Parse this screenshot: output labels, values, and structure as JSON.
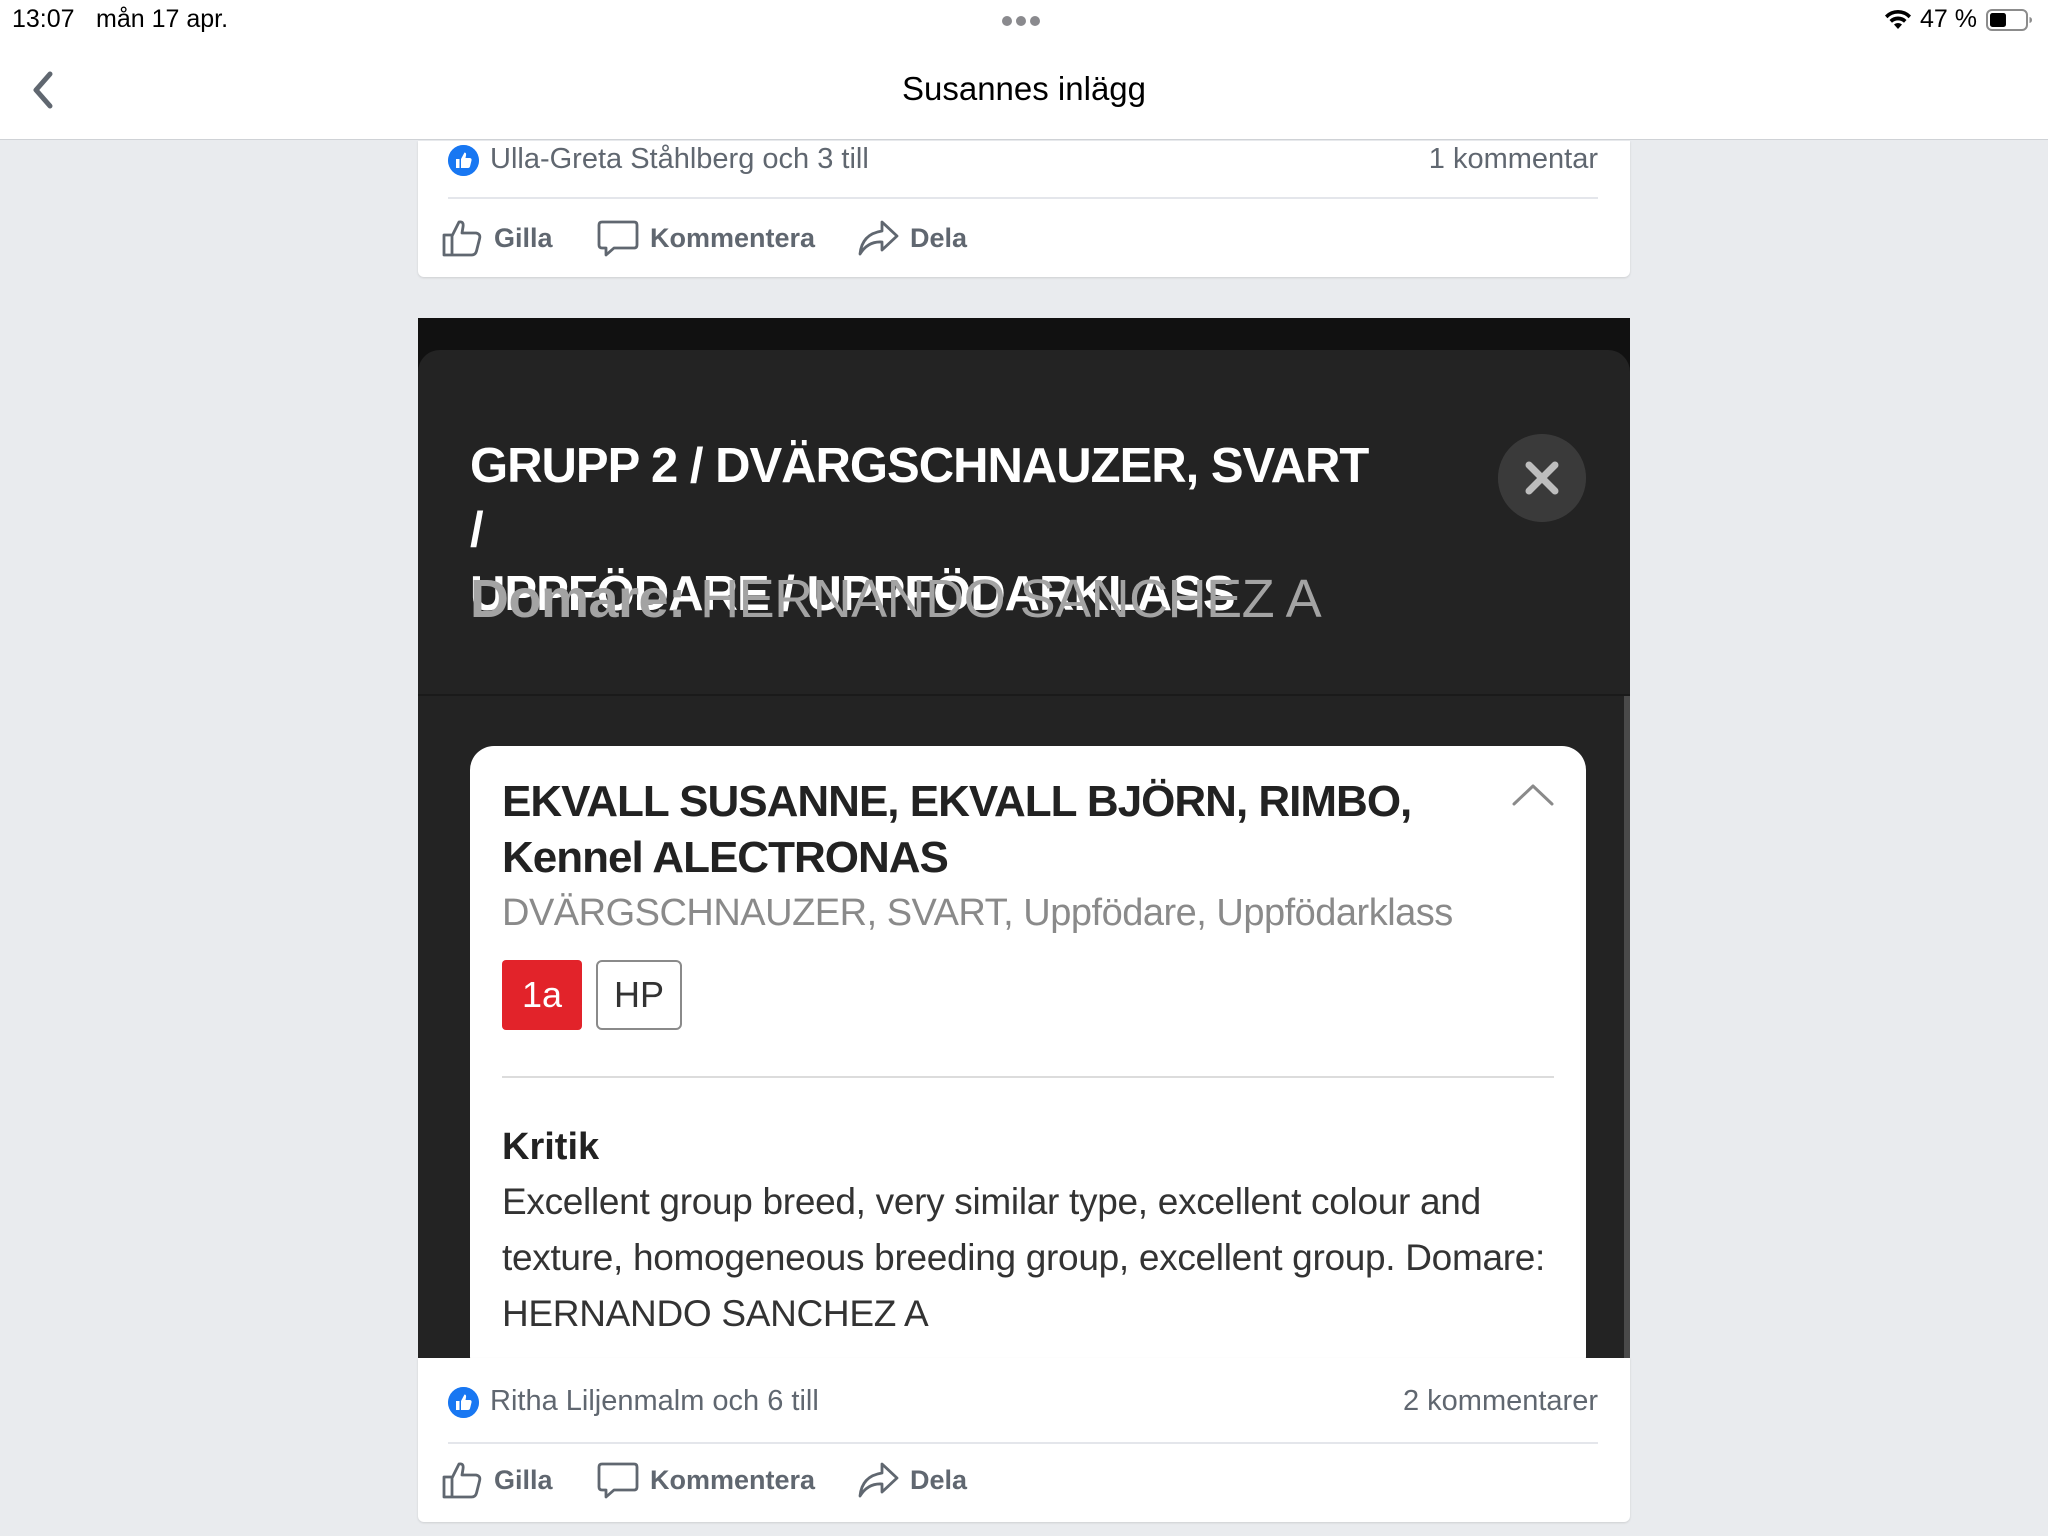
{
  "status_bar": {
    "time": "13:07",
    "date": "mån 17 apr.",
    "battery_percent": "47 %",
    "battery_level": 0.47,
    "icons": [
      "more-dots-icon",
      "wifi-icon",
      "battery-icon"
    ]
  },
  "nav": {
    "title": "Susannes inlägg",
    "back_icon": "chevron-left-icon"
  },
  "colors": {
    "facebook_blue": "#1877f2",
    "action_grey": "#606770",
    "placement_red": "#e2232a",
    "sheet_dark": "#232323"
  },
  "post_top": {
    "reactions_text": "Ulla-Greta Ståhlberg och 3 till",
    "comments_text": "1 kommentar",
    "actions": [
      {
        "label": "Gilla",
        "icon": "thumbs-up-icon"
      },
      {
        "label": "Kommentera",
        "icon": "comment-bubble-icon"
      },
      {
        "label": "Dela",
        "icon": "share-arrow-icon"
      }
    ]
  },
  "post_image": {
    "title_line1": "GRUPP 2 / DVÄRGSCHNAUZER, SVART /",
    "title_line2": "UPPFÖDARE / UPPFÖDARKLASS",
    "judge_label": "Domare:",
    "judge_name": "HERNANDO SANCHEZ A",
    "close_icon": "close-x-icon",
    "result": {
      "title_line1": "EKVALL SUSANNE, EKVALL BJÖRN, RIMBO,",
      "title_line2": "Kennel ALECTRONAS",
      "subtitle": "DVÄRGSCHNAUZER, SVART, Uppfödare, Uppfödarklass",
      "badges": [
        "1a",
        "HP"
      ],
      "critique_heading": "Kritik",
      "critique_text": "Excellent group breed, very similar type, excellent colour and texture, homogeneous breeding group, excellent group. Domare: HERNANDO SANCHEZ A",
      "collapse_icon": "chevron-up-icon"
    }
  },
  "post_bottom": {
    "reactions_text": "Ritha Liljenmalm och 6 till",
    "comments_text": "2 kommentarer",
    "actions": [
      {
        "label": "Gilla",
        "icon": "thumbs-up-icon"
      },
      {
        "label": "Kommentera",
        "icon": "comment-bubble-icon"
      },
      {
        "label": "Dela",
        "icon": "share-arrow-icon"
      }
    ]
  }
}
